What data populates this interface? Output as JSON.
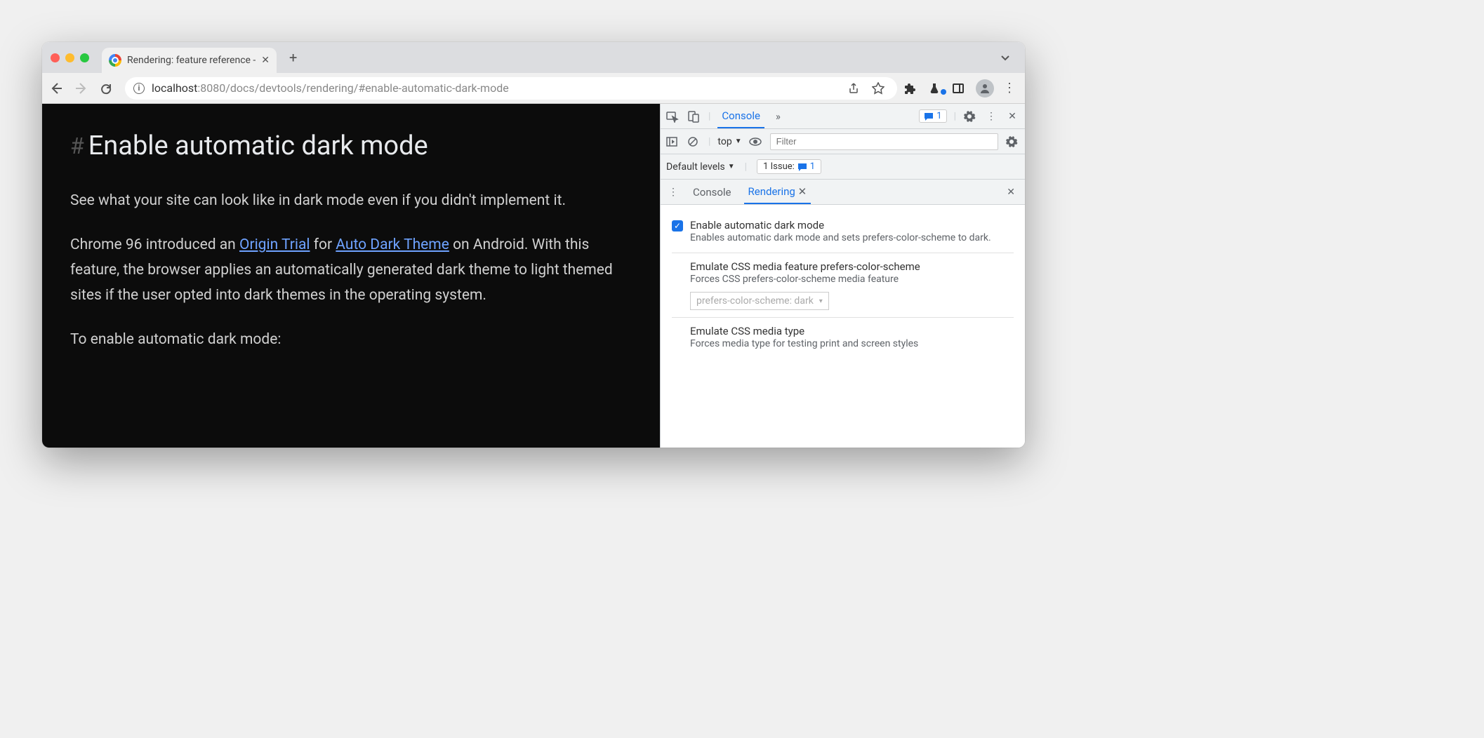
{
  "window": {
    "tab_title": "Rendering: feature reference -",
    "new_tab_tooltip": "+"
  },
  "toolbar": {
    "url_host": "localhost",
    "url_port": ":8080",
    "url_path": "/docs/devtools/rendering/#enable-automatic-dark-mode"
  },
  "page": {
    "heading": "Enable automatic dark mode",
    "p1": "See what your site can look like in dark mode even if you didn't implement it.",
    "p2a": "Chrome 96 introduced an ",
    "link1": "Origin Trial",
    "p2b": " for ",
    "link2": "Auto Dark Theme",
    "p2c": " on Android. With this feature, the browser applies an automatically generated dark theme to light themed sites if the user opted into dark themes in the operating system.",
    "p3": "To enable automatic dark mode:"
  },
  "devtools": {
    "main_tab": "Console",
    "more_tabs": "»",
    "messages_count": "1",
    "context": "top",
    "filter_placeholder": "Filter",
    "levels": "Default levels",
    "issues_label": "1 Issue:",
    "issues_count": "1",
    "drawer": {
      "tab1": "Console",
      "tab2": "Rendering",
      "s1_title": "Enable automatic dark mode",
      "s1_desc": "Enables automatic dark mode and sets prefers-color-scheme to dark.",
      "s2_title": "Emulate CSS media feature prefers-color-scheme",
      "s2_desc": "Forces CSS prefers-color-scheme media feature",
      "s2_value": "prefers-color-scheme: dark",
      "s3_title": "Emulate CSS media type",
      "s3_desc": "Forces media type for testing print and screen styles"
    }
  }
}
